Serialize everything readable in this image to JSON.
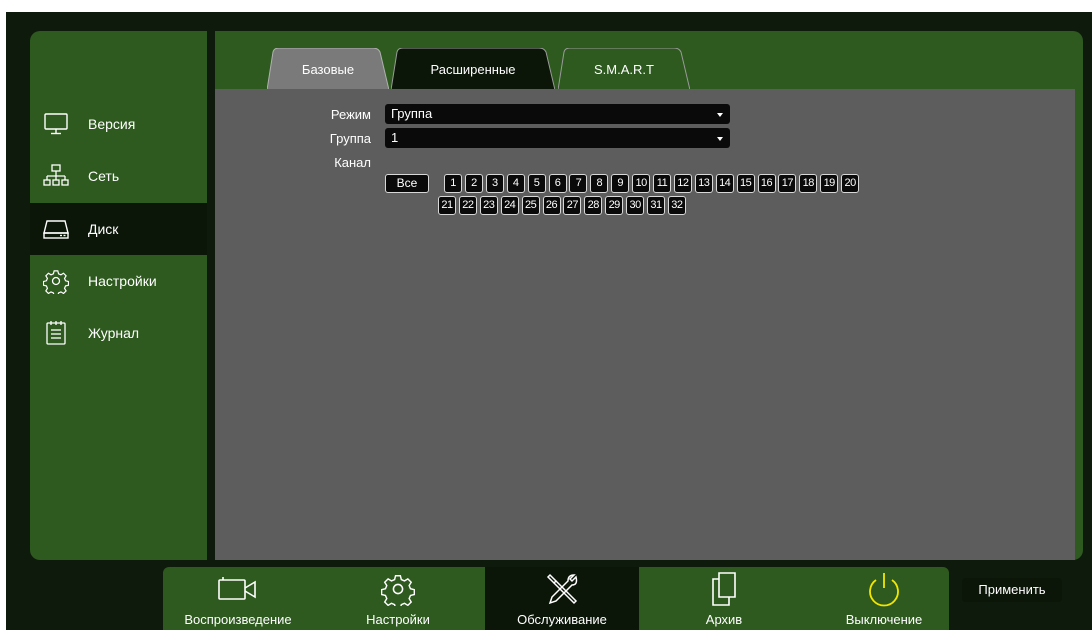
{
  "sidebar": {
    "items": [
      {
        "label": "Версия",
        "icon": "monitor-icon"
      },
      {
        "label": "Сеть",
        "icon": "network-icon"
      },
      {
        "label": "Диск",
        "icon": "hdd-icon",
        "active": true
      },
      {
        "label": "Настройки",
        "icon": "gear-icon"
      },
      {
        "label": "Журнал",
        "icon": "log-icon"
      }
    ]
  },
  "tabs": [
    {
      "label": "Базовые"
    },
    {
      "label": "Расширенные",
      "active": true
    },
    {
      "label": "S.M.A.R.T"
    }
  ],
  "form": {
    "mode": {
      "label": "Режим",
      "value": "Группа"
    },
    "group": {
      "label": "Группа",
      "value": "1"
    },
    "channel": {
      "label": "Канал",
      "all_label": "Все",
      "row1": [
        "1",
        "2",
        "3",
        "4",
        "5",
        "6",
        "7",
        "8",
        "9",
        "10",
        "11",
        "12",
        "13",
        "14",
        "15",
        "16",
        "17",
        "18",
        "19",
        "20"
      ],
      "row2": [
        "21",
        "22",
        "23",
        "24",
        "25",
        "26",
        "27",
        "28",
        "29",
        "30",
        "31",
        "32"
      ]
    }
  },
  "apply_label": "Применить",
  "bottombar": {
    "items": [
      {
        "label": "Воспроизведение",
        "icon": "camera-icon"
      },
      {
        "label": "Настройки",
        "icon": "gear-icon"
      },
      {
        "label": "Обслуживание",
        "icon": "tools-icon",
        "active": true
      },
      {
        "label": "Архив",
        "icon": "files-icon"
      },
      {
        "label": "Выключение",
        "icon": "power-icon"
      }
    ]
  },
  "colors": {
    "panel_green": "#2e5a1f",
    "active_dark": "#0b1608",
    "content_gray": "#5d5d5d",
    "power_yellow": "#f2e600"
  }
}
